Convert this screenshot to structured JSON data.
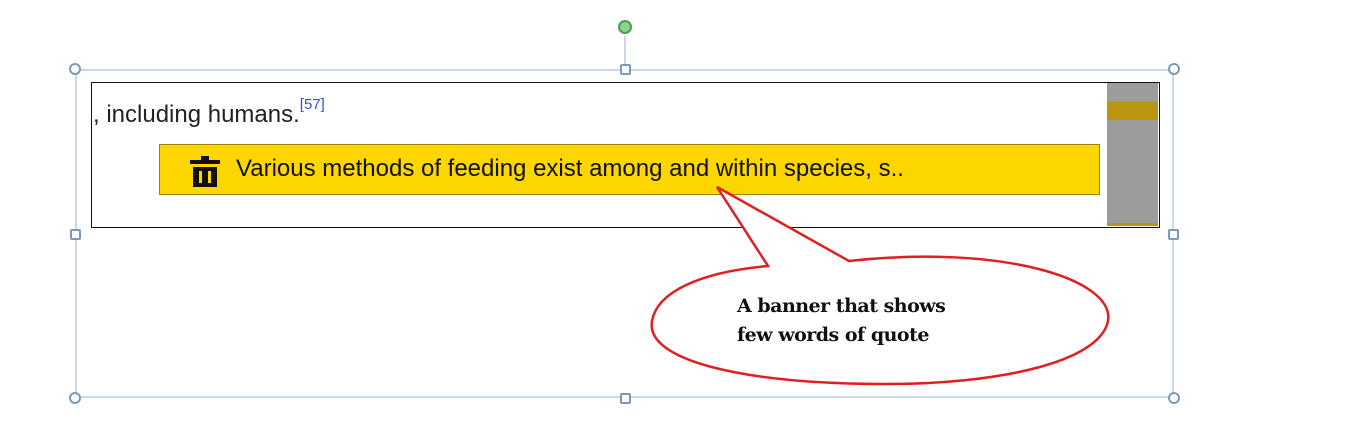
{
  "page": {
    "text": ", including humans.",
    "citation": "[57]"
  },
  "banner": {
    "quote_preview": "Various methods of feeding exist among and within species, s..",
    "delete_icon": "trash-icon",
    "color": "#fdd600"
  },
  "callout": {
    "line1": "A banner that shows",
    "line2": "few words of quote",
    "border_color": "#e02020"
  },
  "selection": {
    "frame_color": "#c8d7ee",
    "rotate_handle_color": "#8fd18f"
  }
}
